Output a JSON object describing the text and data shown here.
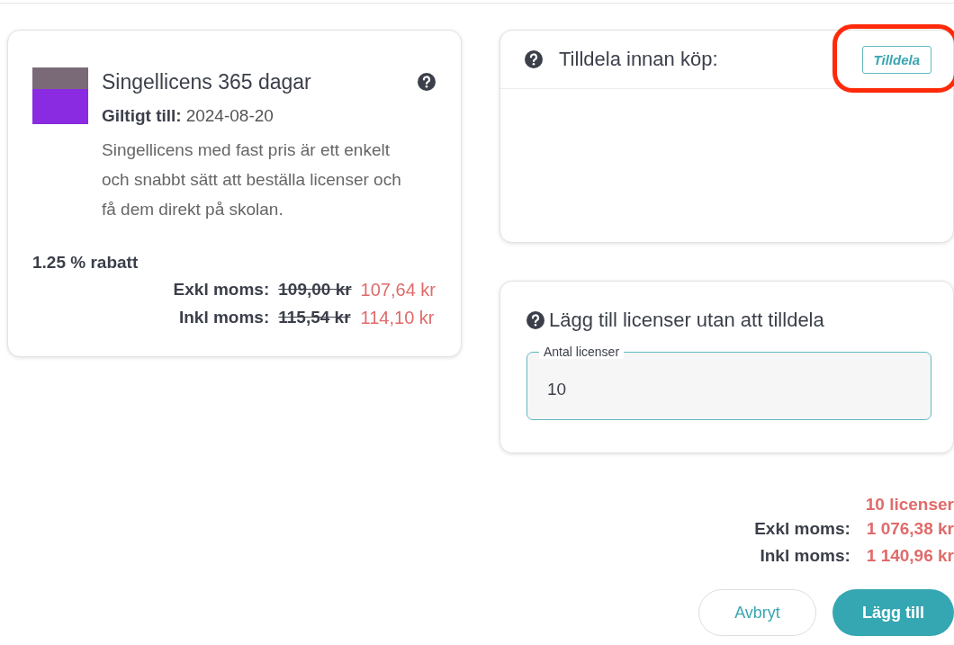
{
  "product": {
    "title": "Singellicens 365 dagar",
    "valid_label": "Giltigt till:",
    "valid_date": "2024-08-20",
    "description": "Singellicens med fast pris är ett enkelt och snabbt sätt att beställa licenser och få dem direkt på skolan.",
    "discount": "1.25 % rabatt",
    "prices": [
      {
        "label": "Exkl moms:",
        "old": "109,00 kr",
        "new": "107,64 kr"
      },
      {
        "label": "Inkl moms:",
        "old": "115,54 kr",
        "new": "114,10 kr"
      }
    ]
  },
  "assign_panel": {
    "title": "Tilldela innan köp:",
    "button": "Tilldela",
    "highlighted": true
  },
  "add_panel": {
    "title": "Lägg till licenser utan att tilldela",
    "field": {
      "label": "Antal licenser",
      "value": "10"
    }
  },
  "totals": {
    "count": "10 licenser",
    "rows": [
      {
        "label": "Exkl moms:",
        "value": "1 076,38 kr"
      },
      {
        "label": "Inkl moms:",
        "value": "1 140,96 kr"
      }
    ]
  },
  "buttons": [
    {
      "label": "Avbryt",
      "kind": "secondary"
    },
    {
      "label": "Lägg till",
      "kind": "primary"
    }
  ]
}
